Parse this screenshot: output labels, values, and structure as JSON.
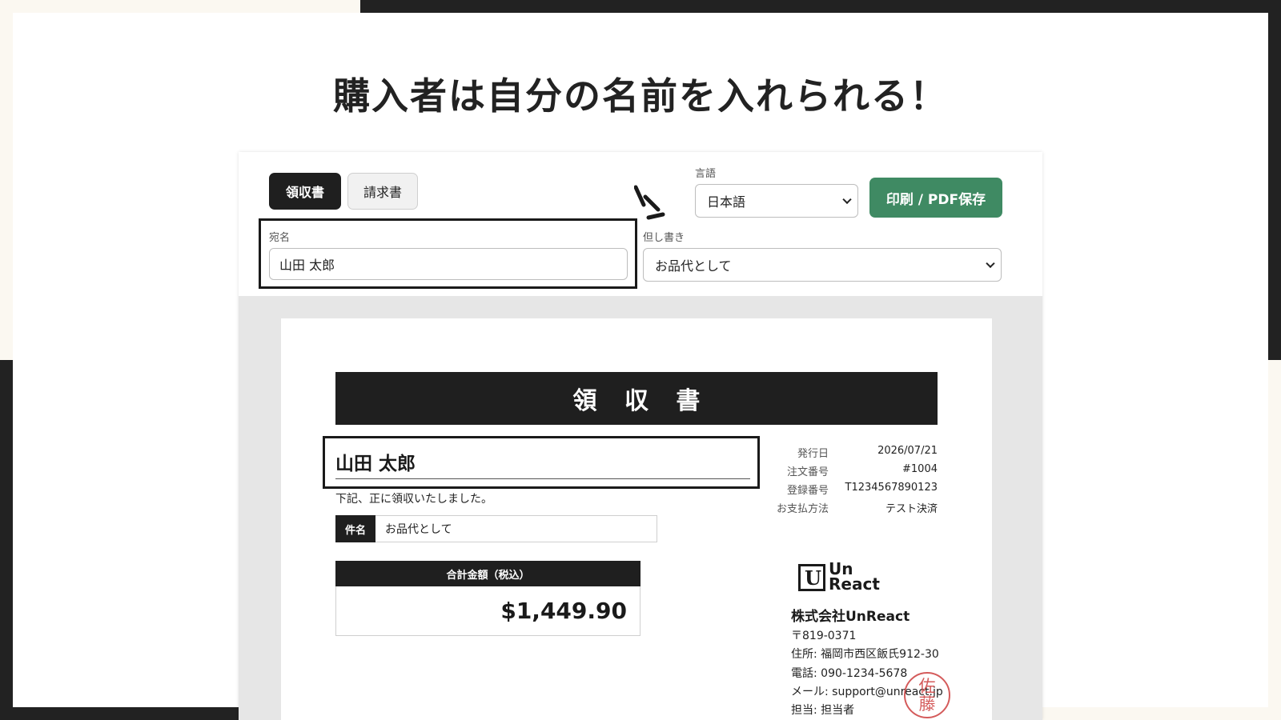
{
  "headline": "購入者は自分の名前を入れられる！",
  "toolbar": {
    "tabs": [
      {
        "label": "領収書",
        "active": true
      },
      {
        "label": "請求書",
        "active": false
      }
    ],
    "language": {
      "label": "言語",
      "value": "日本語"
    },
    "print_button": "印刷 / PDF保存",
    "addressee": {
      "label": "宛名",
      "value": "山田 太郎"
    },
    "memo": {
      "label": "但し書き",
      "value": "お品代として"
    }
  },
  "receipt": {
    "title": "領 収 書",
    "recipient": "山田 太郎",
    "received_text": "下記、正に領収いたしました。",
    "subject": {
      "label": "件名",
      "value": "お品代として"
    },
    "total": {
      "label": "合計金額（税込）",
      "amount": "$1,449.90"
    },
    "meta": [
      {
        "key": "発行日",
        "value": "2026/07/21"
      },
      {
        "key": "注文番号",
        "value": "#1004"
      },
      {
        "key": "登録番号",
        "value": "T1234567890123"
      },
      {
        "key": "お支払方法",
        "value": "テスト決済"
      }
    ],
    "company": {
      "logo_letter": "U",
      "logo_line1": "Un",
      "logo_line2": "React",
      "name": "株式会社UnReact",
      "postal": "〒819-0371",
      "address": "住所: 福岡市西区飯氏912-30",
      "phone": "電話: 090-1234-5678",
      "email": "メール: support@unreact.jp",
      "contact": "担当: 担当者",
      "stamp_line1": "佐",
      "stamp_line2": "藤"
    }
  },
  "colors": {
    "dark": "#1f1f1f",
    "print_button": "#3f8a63",
    "stamp": "#cd3e3e",
    "preview_bg": "#e6e6e6"
  }
}
